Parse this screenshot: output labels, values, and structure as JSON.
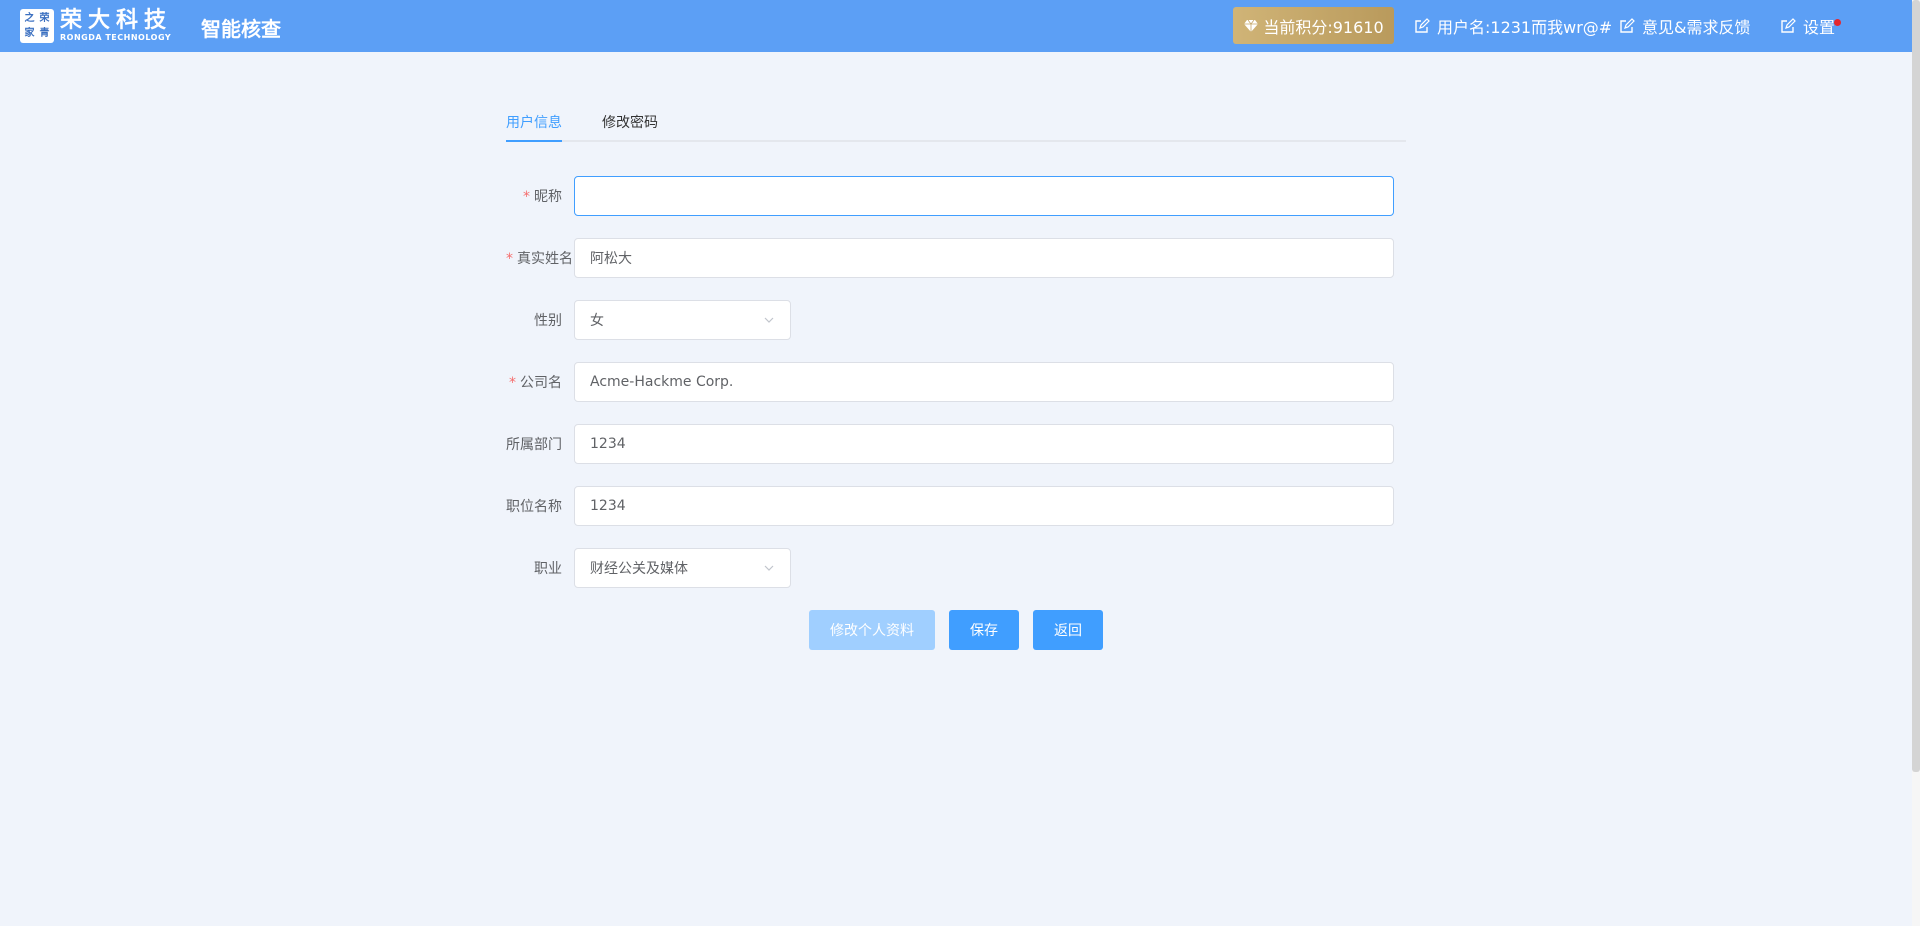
{
  "header": {
    "logo_badge": [
      "之",
      "荣",
      "家",
      "青"
    ],
    "logo_cn": "荣大科技",
    "logo_en": "RONGDA TECHNOLOGY",
    "app_title": "智能核查",
    "points_label": "当前积分:91610",
    "username_label": "用户名:1231而我wr@#",
    "feedback_label": "意见&需求反馈",
    "settings_label": "设置",
    "bg_color": "#5c9ff5",
    "points_color": "#c5a76a"
  },
  "tabs": [
    {
      "label": "用户信息",
      "active": true
    },
    {
      "label": "修改密码",
      "active": false
    }
  ],
  "form": {
    "nickname": {
      "label": "昵称",
      "required": true,
      "value": ""
    },
    "real_name": {
      "label": "真实姓名",
      "required": true,
      "value": "阿松大"
    },
    "gender": {
      "label": "性别",
      "required": false,
      "value": "女"
    },
    "company": {
      "label": "公司名",
      "required": true,
      "value": "Acme-Hackme Corp."
    },
    "department": {
      "label": "所属部门",
      "required": false,
      "value": "1234"
    },
    "position": {
      "label": "职位名称",
      "required": false,
      "value": "1234"
    },
    "occupation": {
      "label": "职业",
      "required": false,
      "value": "财经公关及媒体"
    }
  },
  "buttons": {
    "edit_profile": "修改个人资料",
    "save": "保存",
    "back": "返回"
  },
  "required_mark": "*",
  "colors": {
    "accent": "#409eff",
    "page_bg": "#f0f4fb",
    "required": "#f56c6c"
  }
}
